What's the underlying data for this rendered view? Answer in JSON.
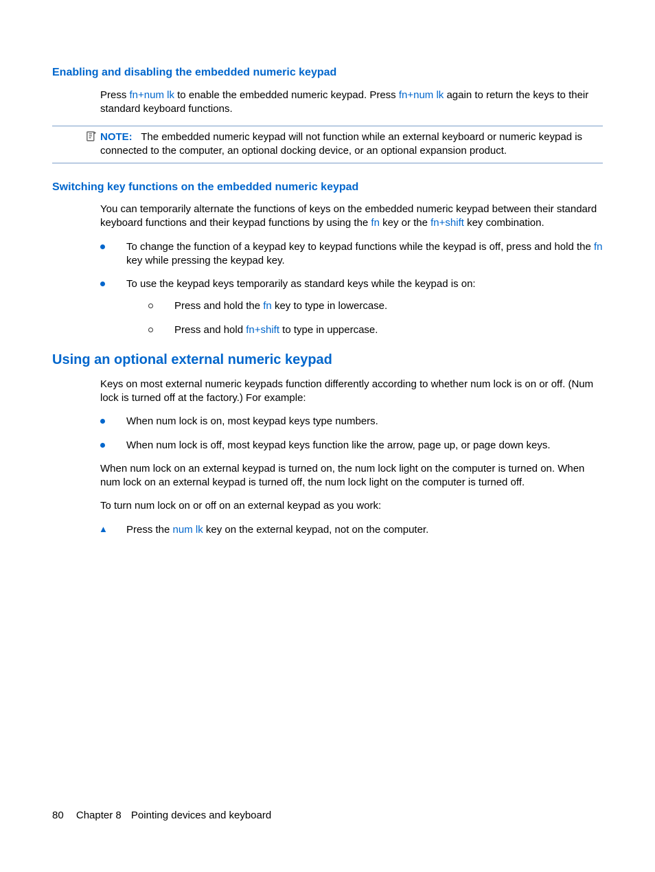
{
  "s1": {
    "heading": "Enabling and disabling the embedded numeric keypad",
    "p1a": "Press ",
    "p1k1": "fn+num lk",
    "p1b": " to enable the embedded numeric keypad. Press ",
    "p1k2": "fn+num lk",
    "p1c": " again to return the keys to their standard keyboard functions.",
    "note_label": "NOTE:",
    "note_text": "The embedded numeric keypad will not function while an external keyboard or numeric keypad is connected to the computer, an optional docking device, or an optional expansion product."
  },
  "s2": {
    "heading": "Switching key functions on the embedded numeric keypad",
    "p1a": "You can temporarily alternate the functions of keys on the embedded numeric keypad between their standard keyboard functions and their keypad functions by using the ",
    "p1k1": "fn",
    "p1b": " key or the ",
    "p1k2": "fn+shift",
    "p1c": " key combination.",
    "b1a": "To change the function of a keypad key to keypad functions while the keypad is off, press and hold the ",
    "b1k": "fn",
    "b1b": " key while pressing the keypad key.",
    "b2": "To use the keypad keys temporarily as standard keys while the keypad is on:",
    "b2s1a": "Press and hold the ",
    "b2s1k": "fn",
    "b2s1b": " key to type in lowercase.",
    "b2s2a": "Press and hold ",
    "b2s2k": "fn+shift",
    "b2s2b": " to type in uppercase."
  },
  "s3": {
    "heading": "Using an optional external numeric keypad",
    "p1": "Keys on most external numeric keypads function differently according to whether num lock is on or off. (Num lock is turned off at the factory.)  For example:",
    "b1": "When num lock is on, most keypad keys type numbers.",
    "b2": "When num lock is off, most keypad keys function like the arrow, page up, or page down keys.",
    "p2": "When num lock on an external keypad is turned on, the num lock light on the computer is turned on. When num lock on an external keypad is turned off, the num lock light on the computer is turned off.",
    "p3": "To turn num lock on or off on an external keypad as you work:",
    "t1a": "Press the ",
    "t1k": "num lk",
    "t1b": " key on the external keypad, not on the computer."
  },
  "footer": {
    "page": "80",
    "chapter": "Chapter 8",
    "title": "Pointing devices and keyboard"
  }
}
